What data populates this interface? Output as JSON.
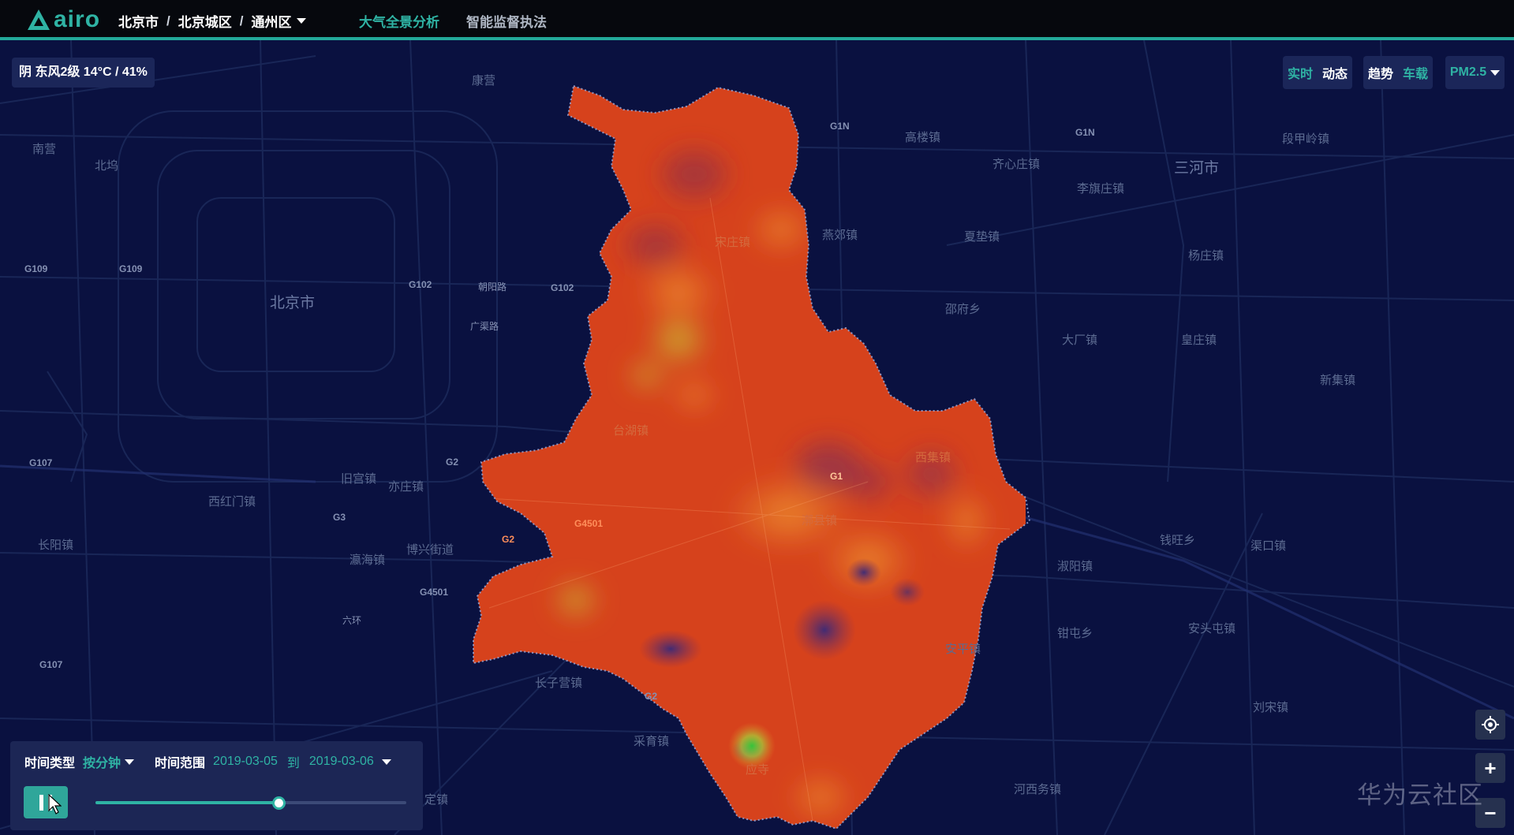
{
  "app": {
    "logo_text": "airo"
  },
  "breadcrumb": {
    "city": "北京市",
    "area": "北京城区",
    "district": "通州区"
  },
  "nav": {
    "tabs": [
      {
        "label": "大气全景分析",
        "active": true
      },
      {
        "label": "智能监督执法",
        "active": false
      }
    ]
  },
  "weather": {
    "text": "阴 东风2级 14°C / 41%"
  },
  "mode_toggle": {
    "realtime": "实时",
    "dynamic": "动态"
  },
  "view_toggle": {
    "trend": "趋势",
    "vehicle": "车载"
  },
  "pollutant": {
    "selected": "PM2.5"
  },
  "time_panel": {
    "time_type_label": "时间类型",
    "time_type_value": "按分钟",
    "range_label": "时间范围",
    "start_date": "2019-03-05",
    "to": "到",
    "end_date": "2019-03-06",
    "progress": 0.59
  },
  "map_labels": {
    "places": [
      "康营",
      "南营",
      "北坞",
      "高楼镇",
      "齐心庄镇",
      "李旗庄镇",
      "三河市",
      "段甲岭镇",
      "北京市",
      "燕郊镇",
      "夏垫镇",
      "杨庄镇",
      "邵府乡",
      "大厂镇",
      "皇庄镇",
      "新集镇",
      "旧宫镇",
      "西红门镇",
      "亦庄镇",
      "长阳镇",
      "博兴街道",
      "瀛海镇",
      "西集镇",
      "钱旺乡",
      "渠口镇",
      "淑阳镇",
      "钳屯乡",
      "安头屯镇",
      "安平镇",
      "长子营镇",
      "刘宋镇",
      "采育镇",
      "河西务镇",
      "定镇",
      "宋庄镇",
      "台湖镇",
      "漷县镇",
      "应寺",
      "朝阳路",
      "广渠路"
    ],
    "roads": [
      "G1N",
      "G1N",
      "G109",
      "G109",
      "G102",
      "G102",
      "G107",
      "G107",
      "G2",
      "G3",
      "G4501",
      "G4501",
      "G2",
      "G2",
      "G1",
      "六环"
    ]
  },
  "watermark": "华为云社区",
  "colors": {
    "accent": "#2fb3a4",
    "map_bg": "#0a1140",
    "panel_bg": "#1c2655",
    "hot": "#d6421c",
    "cool": "#3b2b7a"
  },
  "icons": {
    "locate": "locate-icon",
    "zoom_in": "plus-icon",
    "zoom_out": "minus-icon",
    "play": "pause-icon"
  }
}
